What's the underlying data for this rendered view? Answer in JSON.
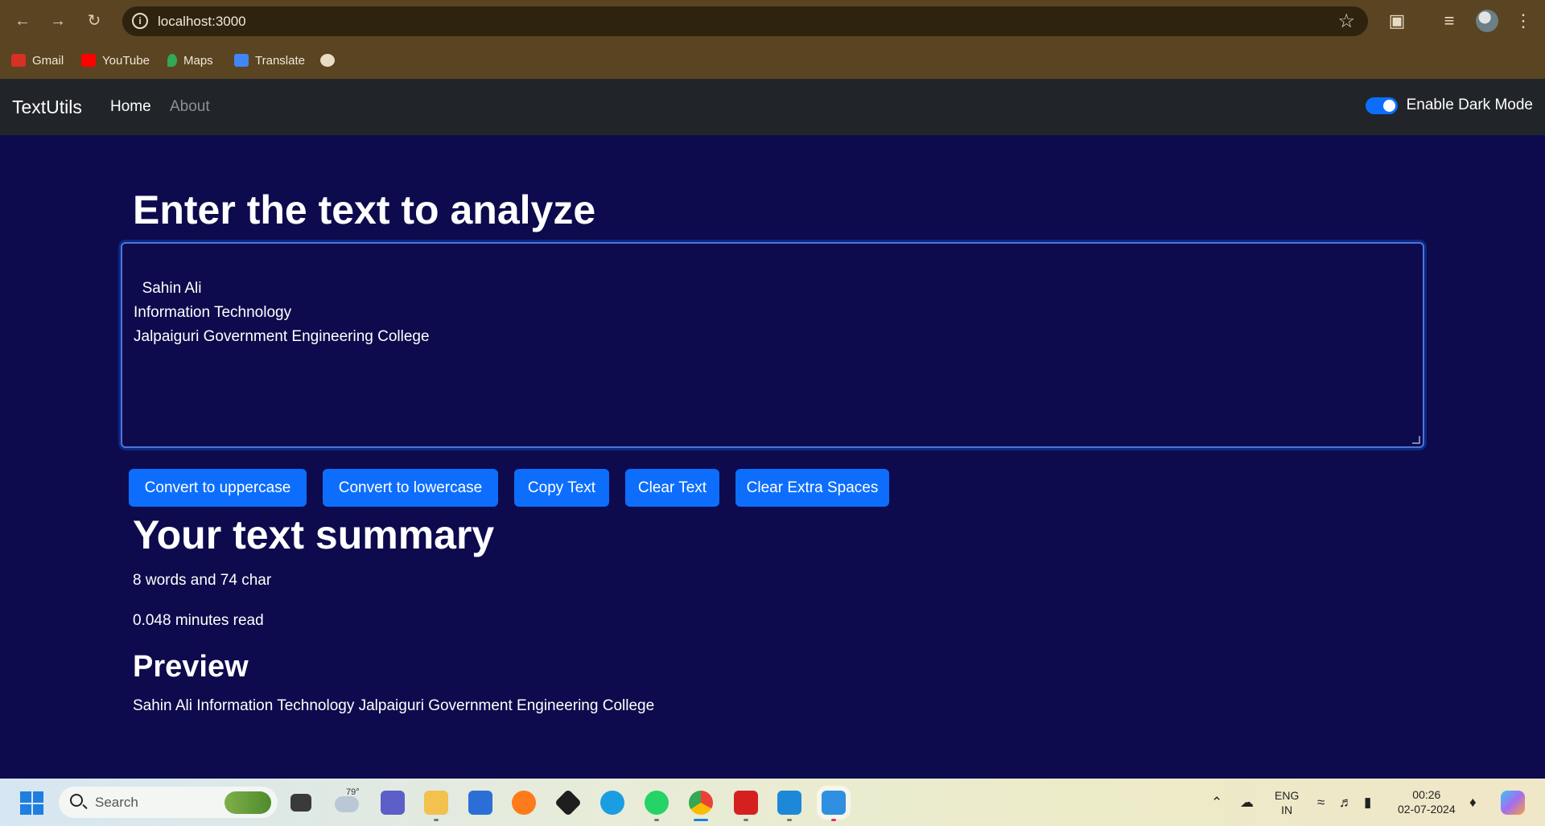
{
  "browser": {
    "url": "localhost:3000",
    "bookmarks": [
      "Gmail",
      "YouTube",
      "Maps",
      "Translate"
    ]
  },
  "navbar": {
    "brand": "TextUtils",
    "links": [
      "Home",
      "About"
    ],
    "dark_mode_label": "Enable Dark Mode",
    "dark_mode_enabled": true
  },
  "form": {
    "heading": "Enter the text to analyze",
    "text_value": "Sahin Ali\nInformation Technology\nJalpaiguri Government Engineering College",
    "buttons": [
      "Convert to uppercase",
      "Convert to lowercase",
      "Copy Text",
      "Clear Text",
      "Clear Extra Spaces"
    ]
  },
  "summary": {
    "heading": "Your text summary",
    "counts": "8 words and 74 char",
    "read_time": "0.048 minutes read",
    "preview_heading": "Preview",
    "preview_text": "Sahin Ali Information Technology Jalpaiguri Government Engineering College"
  },
  "taskbar": {
    "search_placeholder": "Search",
    "weather_temp": "79°",
    "language_top": "ENG",
    "language_bottom": "IN",
    "time": "00:26",
    "date": "02-07-2024"
  },
  "colors": {
    "page_bg": "#0d0b4d",
    "navbar_bg": "#212529",
    "accent": "#0d6efd",
    "chrome_bg": "#5a4422"
  }
}
